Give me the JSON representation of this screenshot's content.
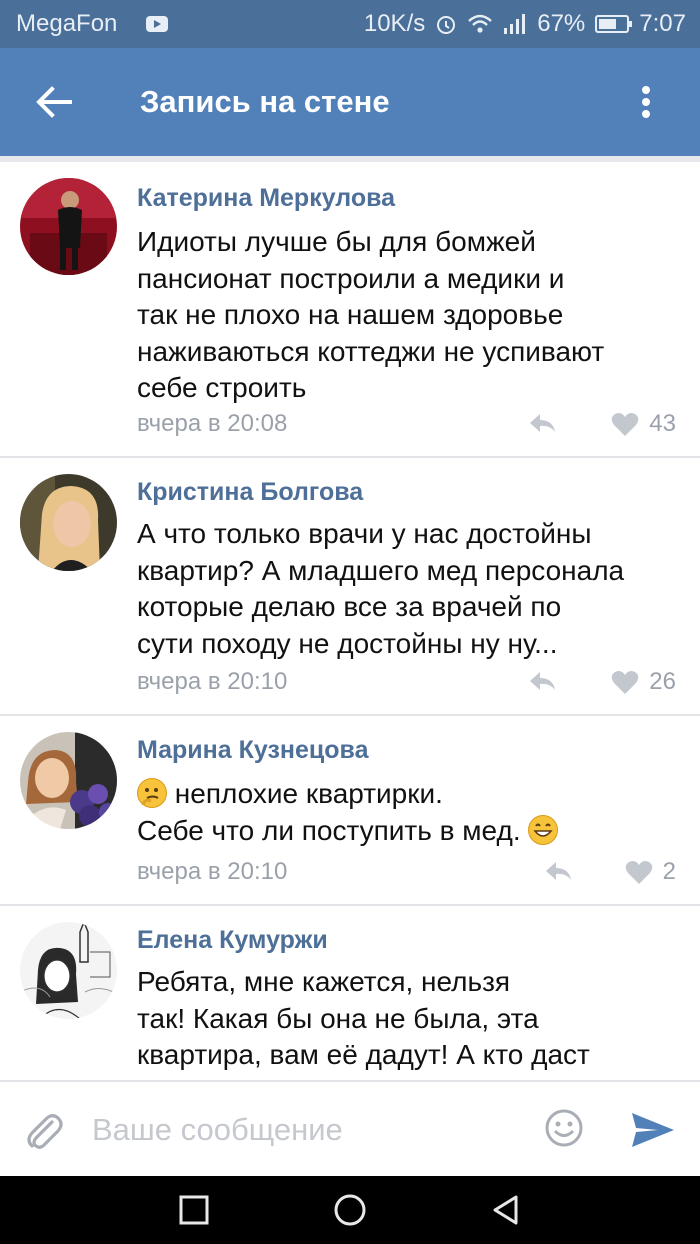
{
  "status_bar": {
    "carrier": "MegaFon",
    "speed": "10K/s",
    "battery": "67%",
    "battery_level": 0.67,
    "time": "7:07"
  },
  "header": {
    "title": "Запись на стене",
    "back_icon": "arrow-left-icon",
    "menu_icon": "more-vertical-icon"
  },
  "comments": [
    {
      "author": "Катерина Меркулова",
      "lines": [
        "Идиоты лучше бы для бомжей",
        "пансионат построили а медики и",
        "так не плохо на нашем здоровье",
        "наживаються коттеджи не успивают",
        "себе строить"
      ],
      "time": "вчера в 20:08",
      "likes": "43"
    },
    {
      "author": "Кристина Болгова",
      "lines": [
        "А что только врачи у нас достойны",
        "квартир? А младшего мед персонала",
        "которые делаю все за врачей по",
        "сути походу не достойны ну ну..."
      ],
      "time": "вчера в 20:10",
      "likes": "26"
    },
    {
      "author": "Марина Кузнецова",
      "line1_text": "неплохие квартирки.",
      "line2_text": "Себе что ли поступить в мед.",
      "emoji_1": "thinking-face-emoji",
      "emoji_2": "grinning-face-emoji",
      "time": "вчера в 20:10",
      "likes": "2"
    },
    {
      "author": "Елена Кумуржи",
      "lines": [
        "Ребята, мне кажется, нельзя",
        "так! Какая бы она не была, эта",
        "квартира, вам её дадут! А кто даст"
      ]
    }
  ],
  "composer": {
    "placeholder": "Ваше сообщение",
    "attach_icon": "paperclip-icon",
    "emoji_icon": "smile-icon",
    "send_icon": "send-icon"
  },
  "colors": {
    "status_bar": "#4a6f99",
    "app_bar": "#5181b8",
    "author_name": "#4d6f98",
    "meta_text": "#9aa1aa",
    "send_accent": "#5181b8"
  }
}
